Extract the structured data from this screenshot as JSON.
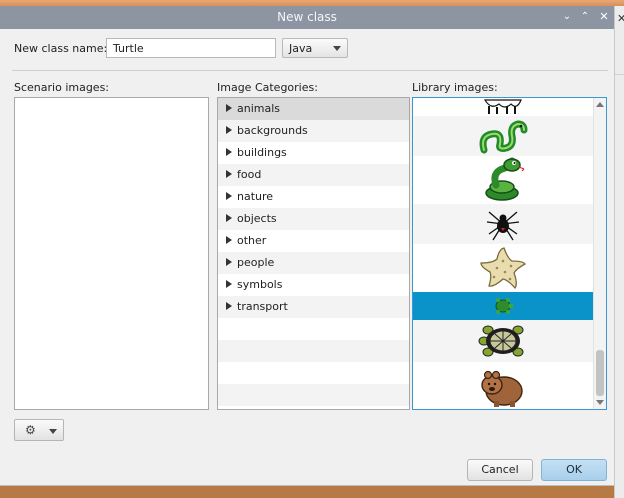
{
  "window": {
    "title": "New class",
    "controls": {
      "minimize_icon": "chevron-down-icon",
      "maximize_icon": "chevron-up-icon",
      "close_icon": "close-icon"
    }
  },
  "form": {
    "name_label": "New class name:",
    "name_value": "Turtle",
    "language": "Java"
  },
  "sections": {
    "scenario_label": "Scenario images:",
    "categories_label": "Image Categories:",
    "library_label": "Library images:"
  },
  "categories": [
    {
      "label": "animals",
      "selected": true
    },
    {
      "label": "backgrounds"
    },
    {
      "label": "buildings"
    },
    {
      "label": "food"
    },
    {
      "label": "nature"
    },
    {
      "label": "objects"
    },
    {
      "label": "other"
    },
    {
      "label": "people"
    },
    {
      "label": "symbols"
    },
    {
      "label": "transport"
    }
  ],
  "library_images": [
    {
      "icon": "animal-partial-icon"
    },
    {
      "icon": "snake-green-icon"
    },
    {
      "icon": "snake-coiled-icon"
    },
    {
      "icon": "spider-icon"
    },
    {
      "icon": "starfish-icon"
    },
    {
      "icon": "turtle-small-icon",
      "selected": true
    },
    {
      "icon": "turtle-icon"
    },
    {
      "icon": "wombat-icon"
    }
  ],
  "toolbar": {
    "gear_icon": "gear-icon"
  },
  "buttons": {
    "cancel": "Cancel",
    "ok": "OK"
  },
  "colors": {
    "titlebar": "#8c95a1",
    "selection": "#0a93c9",
    "ok_button": "#b6d7ef"
  }
}
